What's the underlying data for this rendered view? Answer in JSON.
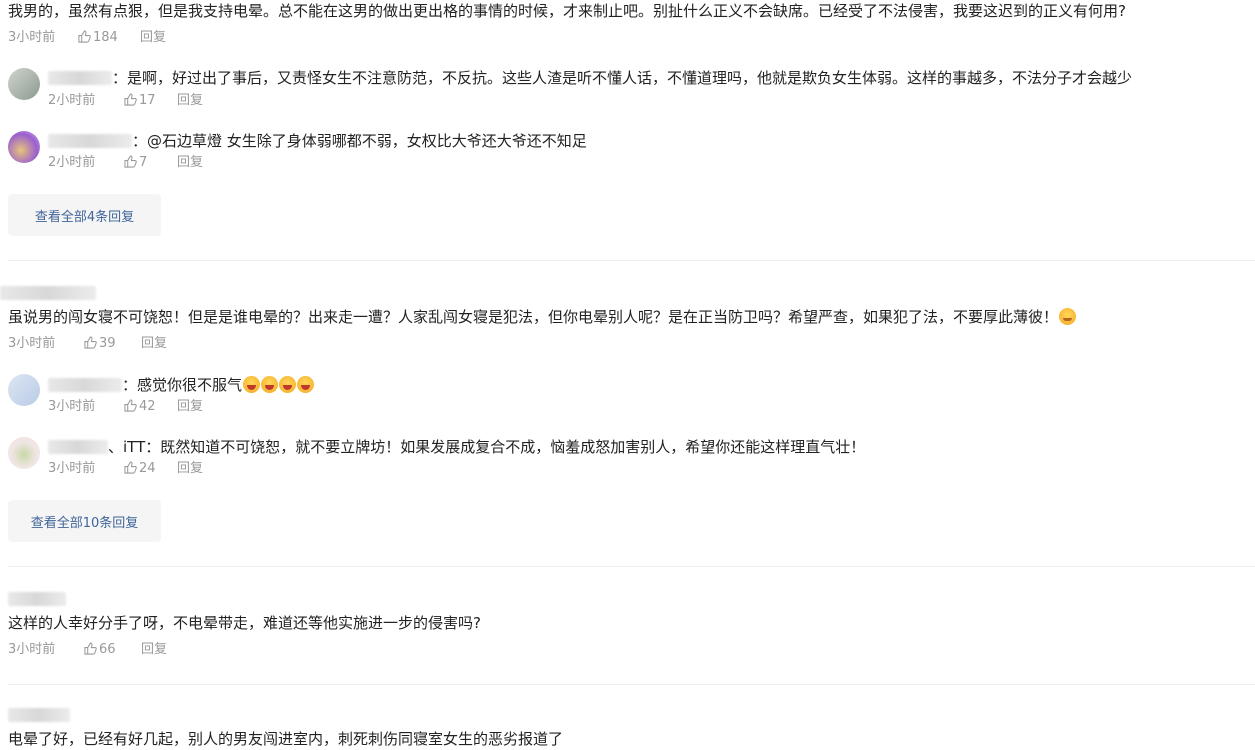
{
  "comments": [
    {
      "text": "我男的，虽然有点狠，但是我支持电晕。总不能在这男的做出更出格的事情的时候，才来制止吧。别扯什么正义不会缺席。已经受了不法侵害，我要这迟到的正义有何用?",
      "time": "3小时前",
      "likes": "184",
      "reply": "回复",
      "replies": [
        {
          "prefix": "：",
          "text": "是啊，好过出了事后，又责怪女生不注意防范，不反抗。这些人渣是听不懂人话，不懂道理吗，他就是欺负女生体弱。这样的事越多，不法分子才会越少",
          "time": "2小时前",
          "likes": "17",
          "reply": "回复"
        },
        {
          "prefix": "：",
          "text": "@石边草燈 女生除了身体弱哪都不弱，女权比大爷还大爷还不知足",
          "time": "2小时前",
          "likes": "7",
          "reply": "回复"
        }
      ],
      "view_all": "查看全部4条回复"
    },
    {
      "text": "虽说男的闯女寝不可饶恕！但是是谁电晕的？出来走一遭？人家乱闯女寝是犯法，但你电晕别人呢？是在正当防卫吗？希望严查，如果犯了法，不要厚此薄彼！",
      "time": "3小时前",
      "likes": "39",
      "reply": "回复",
      "replies": [
        {
          "prefix": "：",
          "text": "感觉你很不服气",
          "time": "3小时前",
          "likes": "42",
          "reply": "回复"
        },
        {
          "prefix": "、iTT：",
          "text": "既然知道不可饶恕，就不要立牌坊！如果发展成复合不成，恼羞成怒加害别人，希望你还能这样理直气壮！",
          "time": "3小时前",
          "likes": "24",
          "reply": "回复"
        }
      ],
      "view_all": "查看全部10条回复"
    },
    {
      "text": "这样的人幸好分手了呀，不电晕带走，难道还等他实施进一步的侵害吗?",
      "time": "3小时前",
      "likes": "66",
      "reply": "回复"
    },
    {
      "text": "电晕了好，已经有好几起，别人的男友闯进室内，刺死刺伤同寝室女生的恶劣报道了"
    }
  ],
  "icons": {
    "like": "thumbs-up-icon",
    "emoji_laugh": "laughing-emoji-icon",
    "emoji_calm": "relieved-emoji-icon"
  },
  "colors": {
    "link": "#406599",
    "meta": "#999999",
    "text": "#222222"
  }
}
